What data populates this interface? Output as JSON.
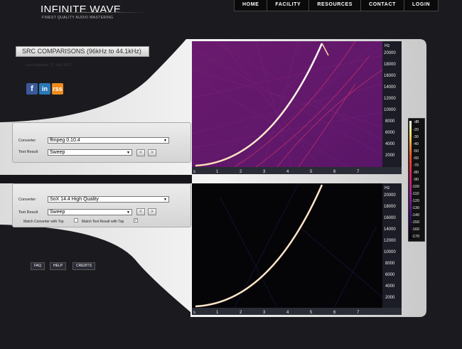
{
  "brand": {
    "name": "INFINITE WAVE",
    "tagline": "FINEST QUALITY AUDIO MASTERING"
  },
  "nav": [
    "HOME",
    "FACILITY",
    "RESOURCES",
    "CONTACT",
    "LOGIN"
  ],
  "page": {
    "title": "SRC COMPARISONS (96kHz to 44.1kHz)",
    "updated": "Last Updated: 17 July 2017"
  },
  "social": {
    "facebook": "f",
    "linkedin": "in",
    "rss": "rss"
  },
  "top_panel": {
    "converter_label": "Converter",
    "converter_value": "ffmpeg 0.10.4",
    "test_label": "Test Result",
    "test_value": "Sweep",
    "prev": "<",
    "next": ">"
  },
  "bottom_panel": {
    "converter_label": "Converter",
    "converter_value": "SoX 14.4 High Quality",
    "test_label": "Test Result",
    "test_value": "Sweep",
    "prev": "<",
    "next": ">",
    "match_converter": "Match Converter with Top",
    "match_test": "Match Test Result with Top",
    "match_converter_checked": false,
    "match_test_checked": true,
    "check_mark": "✓"
  },
  "footer_links": [
    "FAQ",
    "HELP",
    "CREDITS"
  ],
  "spectrogram": {
    "y_unit": "Hz",
    "y_ticks": [
      "20000",
      "18000",
      "16000",
      "14000",
      "12000",
      "10000",
      "8000",
      "6000",
      "4000",
      "2000"
    ],
    "x_unit": "s",
    "x_ticks": [
      "1",
      "2",
      "3",
      "4",
      "5",
      "6",
      "7"
    ]
  },
  "legend": {
    "unit": "dB",
    "ticks": [
      "-20",
      "-30",
      "-40",
      "-50",
      "-60",
      "-70",
      "-80",
      "-90",
      "-100",
      "-110",
      "-120",
      "-130",
      "-140",
      "-150",
      "-160",
      "-170"
    ]
  }
}
